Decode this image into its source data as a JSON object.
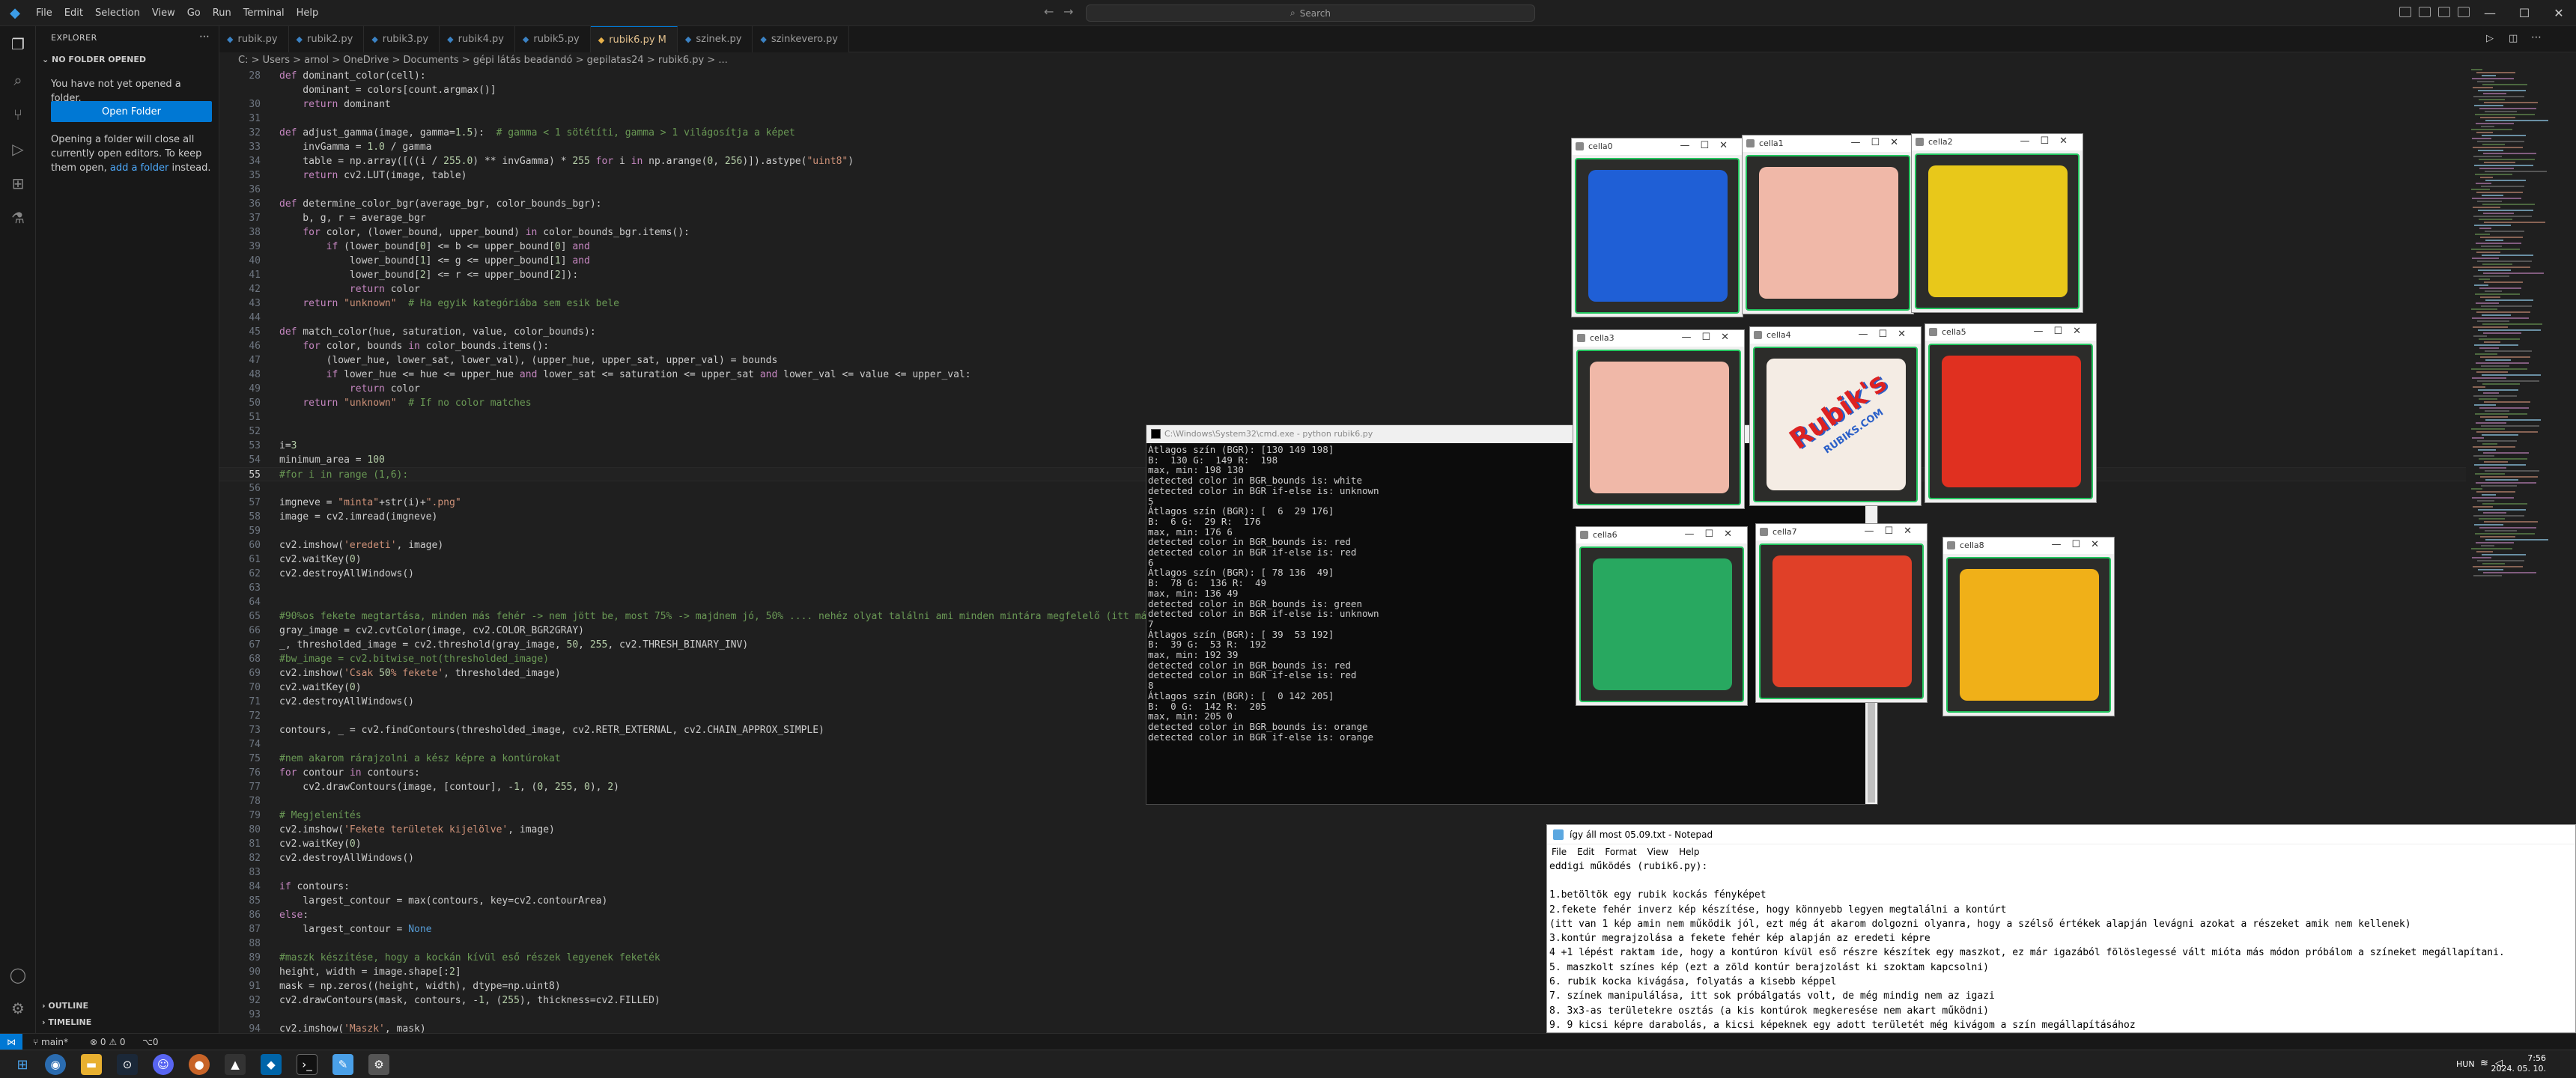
{
  "titlebar": {
    "menu": [
      "File",
      "Edit",
      "Selection",
      "View",
      "Go",
      "Run",
      "Terminal",
      "Help"
    ],
    "search_placeholder": "Search"
  },
  "sidebar": {
    "title": "EXPLORER",
    "section": "NO FOLDER OPENED",
    "msg1": "You have not yet opened a folder.",
    "open_folder": "Open Folder",
    "msg2_a": "Opening a folder will close all currently open editors. To keep them open,",
    "msg2_link": "add a folder",
    "msg2_b": "instead.",
    "outline": "OUTLINE",
    "timeline": "TIMELINE"
  },
  "tabs": [
    {
      "label": "rubik.py",
      "active": false
    },
    {
      "label": "rubik2.py",
      "active": false
    },
    {
      "label": "rubik3.py",
      "active": false
    },
    {
      "label": "rubik4.py",
      "active": false
    },
    {
      "label": "rubik5.py",
      "active": false
    },
    {
      "label": "rubik6.py M",
      "active": true
    },
    {
      "label": "szinek.py",
      "active": false
    },
    {
      "label": "szinkevero.py",
      "active": false
    }
  ],
  "breadcrumb": "C: > Users > arnol > OneDrive > Documents > gépi látás beadandó > gepilatas24 > rubik6.py > ...",
  "code": [
    {
      "n": "28",
      "t": "def dominant_color(cell):"
    },
    {
      "n": "",
      "t": "    dominant = colors[count.argmax()]"
    },
    {
      "n": "30",
      "t": "    return dominant"
    },
    {
      "n": "31",
      "t": ""
    },
    {
      "n": "32",
      "t": "def adjust_gamma(image, gamma=1.5):  # gamma < 1 sötétíti, gamma > 1 világosítja a képet"
    },
    {
      "n": "33",
      "t": "    invGamma = 1.0 / gamma"
    },
    {
      "n": "34",
      "t": "    table = np.array([((i / 255.0) ** invGamma) * 255 for i in np.arange(0, 256)]).astype(\"uint8\")"
    },
    {
      "n": "35",
      "t": "    return cv2.LUT(image, table)"
    },
    {
      "n": "36",
      "t": ""
    },
    {
      "n": "36",
      "t": "def determine_color_bgr(average_bgr, color_bounds_bgr):"
    },
    {
      "n": "37",
      "t": "    b, g, r = average_bgr"
    },
    {
      "n": "38",
      "t": "    for color, (lower_bound, upper_bound) in color_bounds_bgr.items():"
    },
    {
      "n": "39",
      "t": "        if (lower_bound[0] <= b <= upper_bound[0] and"
    },
    {
      "n": "40",
      "t": "            lower_bound[1] <= g <= upper_bound[1] and"
    },
    {
      "n": "41",
      "t": "            lower_bound[2] <= r <= upper_bound[2]):"
    },
    {
      "n": "42",
      "t": "            return color"
    },
    {
      "n": "43",
      "t": "    return \"unknown\"  # Ha egyik kategóriába sem esik bele"
    },
    {
      "n": "44",
      "t": ""
    },
    {
      "n": "45",
      "t": "def match_color(hue, saturation, value, color_bounds):"
    },
    {
      "n": "46",
      "t": "    for color, bounds in color_bounds.items():"
    },
    {
      "n": "47",
      "t": "        (lower_hue, lower_sat, lower_val), (upper_hue, upper_sat, upper_val) = bounds"
    },
    {
      "n": "48",
      "t": "        if lower_hue <= hue <= upper_hue and lower_sat <= saturation <= upper_sat and lower_val <= value <= upper_val:"
    },
    {
      "n": "49",
      "t": "            return color"
    },
    {
      "n": "50",
      "t": "    return \"unknown\"  # If no color matches"
    },
    {
      "n": "51",
      "t": ""
    },
    {
      "n": "52",
      "t": ""
    },
    {
      "n": "53",
      "t": "i=3"
    },
    {
      "n": "54",
      "t": "minimum_area = 100"
    },
    {
      "n": "55",
      "t": "#for i in range (1,6):"
    },
    {
      "n": "56",
      "t": ""
    },
    {
      "n": "57",
      "t": "imgneve = \"minta\"+str(i)+\".png\""
    },
    {
      "n": "58",
      "t": "image = cv2.imread(imgneve)"
    },
    {
      "n": "59",
      "t": ""
    },
    {
      "n": "60",
      "t": "cv2.imshow('eredeti', image)"
    },
    {
      "n": "61",
      "t": "cv2.waitKey(0)"
    },
    {
      "n": "62",
      "t": "cv2.destroyAllWindows()"
    },
    {
      "n": "63",
      "t": ""
    },
    {
      "n": "64",
      "t": ""
    },
    {
      "n": "65",
      "t": "#90%os fekete megtartása, minden más fehér -> nem jött be, most 75% -> majdnem jó, 50% .... nehéz olyat találni ami minden mintára megfelelő (itt már"
    },
    {
      "n": "66",
      "t": "gray_image = cv2.cvtColor(image, cv2.COLOR_BGR2GRAY)"
    },
    {
      "n": "67",
      "t": "_, thresholded_image = cv2.threshold(gray_image, 50, 255, cv2.THRESH_BINARY_INV)"
    },
    {
      "n": "68",
      "t": "#bw_image = cv2.bitwise_not(thresholded_image)"
    },
    {
      "n": "69",
      "t": "cv2.imshow('Csak 50% fekete', thresholded_image)"
    },
    {
      "n": "70",
      "t": "cv2.waitKey(0)"
    },
    {
      "n": "71",
      "t": "cv2.destroyAllWindows()"
    },
    {
      "n": "72",
      "t": ""
    },
    {
      "n": "73",
      "t": "contours, _ = cv2.findContours(thresholded_image, cv2.RETR_EXTERNAL, cv2.CHAIN_APPROX_SIMPLE)"
    },
    {
      "n": "74",
      "t": ""
    },
    {
      "n": "75",
      "t": "#nem akarom rárajzolni a kész képre a kontúrokat"
    },
    {
      "n": "76",
      "t": "for contour in contours:"
    },
    {
      "n": "77",
      "t": "    cv2.drawContours(image, [contour], -1, (0, 255, 0), 2)"
    },
    {
      "n": "78",
      "t": ""
    },
    {
      "n": "79",
      "t": "# Megjelenítés"
    },
    {
      "n": "80",
      "t": "cv2.imshow('Fekete területek kijelölve', image)"
    },
    {
      "n": "81",
      "t": "cv2.waitKey(0)"
    },
    {
      "n": "82",
      "t": "cv2.destroyAllWindows()"
    },
    {
      "n": "83",
      "t": ""
    },
    {
      "n": "84",
      "t": "if contours:"
    },
    {
      "n": "85",
      "t": "    largest_contour = max(contours, key=cv2.contourArea)"
    },
    {
      "n": "86",
      "t": "else:"
    },
    {
      "n": "87",
      "t": "    largest_contour = None"
    },
    {
      "n": "88",
      "t": ""
    },
    {
      "n": "89",
      "t": "#maszk készítése, hogy a kockán kívül eső részek legyenek feketék"
    },
    {
      "n": "90",
      "t": "height, width = image.shape[:2]"
    },
    {
      "n": "91",
      "t": "mask = np.zeros((height, width), dtype=np.uint8)"
    },
    {
      "n": "92",
      "t": "cv2.drawContours(mask, contours, -1, (255), thickness=cv2.FILLED)"
    },
    {
      "n": "93",
      "t": ""
    },
    {
      "n": "94",
      "t": "cv2.imshow('Maszk', mask)"
    }
  ],
  "cmd": {
    "title": "C:\\Windows\\System32\\cmd.exe - python  rubik6.py",
    "lines": [
      "Átlagos szín (BGR): [130 149 198]",
      "B:  130 G:  149 R:  198",
      "max, min: 198 130",
      "detected color in BGR_bounds is: white",
      "detected color in BGR if-else is: unknown",
      "5",
      "Átlagos szín (BGR): [  6  29 176]",
      "B:  6 G:  29 R:  176",
      "max, min: 176 6",
      "detected color in BGR_bounds is: red",
      "detected color in BGR if-else is: red",
      "6",
      "Átlagos szín (BGR): [ 78 136  49]",
      "B:  78 G:  136 R:  49",
      "max, min: 136 49",
      "detected color in BGR_bounds is: green",
      "detected color in BGR if-else is: unknown",
      "7",
      "Átlagos szín (BGR): [ 39  53 192]",
      "B:  39 G:  53 R:  192",
      "max, min: 192 39",
      "detected color in BGR_bounds is: red",
      "detected color in BGR if-else is: red",
      "8",
      "Átlagos szín (BGR): [  0 142 205]",
      "B:  0 G:  142 R:  205",
      "max, min: 205 0",
      "detected color in BGR_bounds is: orange",
      "detected color in BGR if-else is: orange"
    ]
  },
  "cells": [
    {
      "title": "cella0",
      "color": "#1f5fd6"
    },
    {
      "title": "cella1",
      "color": "#f0b8a8"
    },
    {
      "title": "cella2",
      "color": "#e8c81a"
    },
    {
      "title": "cella3",
      "color": "#f0b8a8"
    },
    {
      "title": "cella4",
      "color": "#f4ece4",
      "logo": "Rubik's",
      "logo2": "RUBIKS.COM"
    },
    {
      "title": "cella5",
      "color": "#e03020"
    },
    {
      "title": "cella6",
      "color": "#28a860"
    },
    {
      "title": "cella7",
      "color": "#e04028"
    },
    {
      "title": "cella8",
      "color": "#f0b018"
    }
  ],
  "notepad": {
    "title": "így áll most 05.09.txt - Notepad",
    "menu": [
      "File",
      "Edit",
      "Format",
      "View",
      "Help"
    ],
    "lines": [
      "eddigi működés (rubik6.py):",
      "",
      "1.betöltök egy rubik kockás fényképet",
      "2.fekete fehér inverz kép készítése, hogy könnyebb legyen megtalálni a kontúrt",
      "(itt van 1 kép amin nem működik jól, ezt még át akarom dolgozni olyanra, hogy a szélső értékek alapján levágni azokat a részeket amik nem kellenek)",
      "3.kontúr megrajzolása a fekete fehér kép alapján az eredeti képre",
      "4 +1 lépést raktam ide, hogy a kontúron kívül eső részre készítek egy maszkot, ez már igazából fölöslegessé vált mióta más módon próbálom a színeket megállapítani.",
      "5. maszkolt színes kép (ezt a zöld kontúr berajzolást ki szoktam kapcsolni)",
      "6. rubik kocka kivágása, folyatás a kisebb képpel",
      "7. színek manipulálása, itt sok próbálgatás volt, de még mindig nem az igazi",
      "8. 3x3-as területekre osztás (a kis kontúrok megkeresése nem akart működni)",
      "9. 9 kicsi képre darabolás, a kicsi képeknek egy adott területét még kivágom a szín megállapításához",
      "|"
    ]
  },
  "statusbar": {
    "branch": "main*",
    "problems": "⊗ 0 ⚠ 0",
    "ports": "⌥0"
  },
  "taskbar": {
    "lang": "HUN",
    "time": "7:56",
    "date": "2024. 05. 10."
  }
}
